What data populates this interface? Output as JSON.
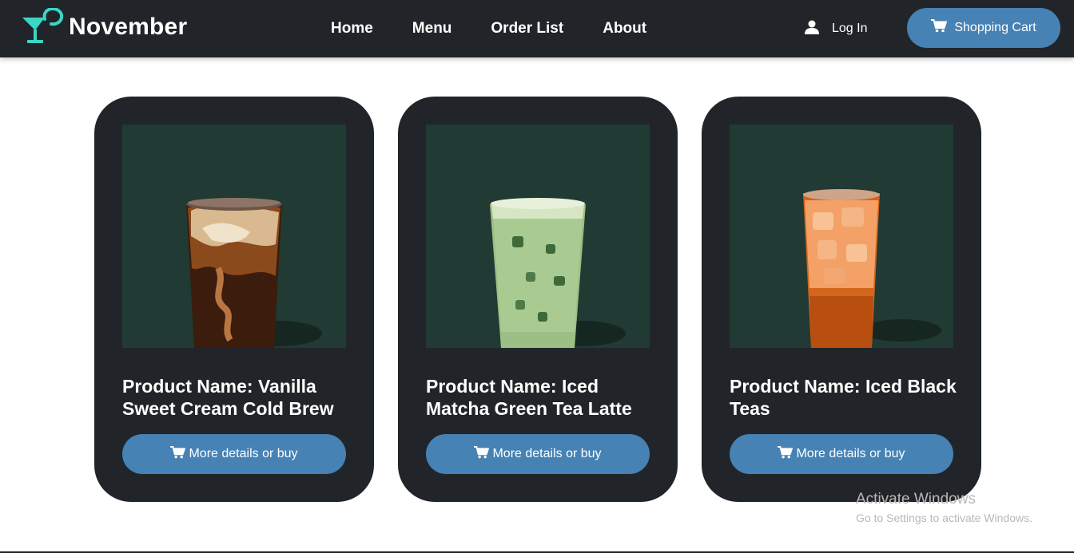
{
  "brand": {
    "name": "November",
    "icon": "cocktail-glass-icon",
    "accent": "#3ad6c6"
  },
  "nav": {
    "links": [
      "Home",
      "Menu",
      "Order List",
      "About"
    ],
    "login_label": "Log In",
    "cart_label": "Shopping Cart"
  },
  "colors": {
    "navbar": "#212529",
    "button": "#4682b4",
    "card": "#212529",
    "image_bg": "#213a33"
  },
  "products": [
    {
      "title": "Product Name: Vanilla Sweet Cream Cold Brew",
      "button": "More details or buy",
      "image": "vanilla-sweet-cream-cold-brew-photo"
    },
    {
      "title": "Product Name: Iced Matcha Green Tea Latte",
      "button": "More details or buy",
      "image": "iced-matcha-green-tea-latte-photo"
    },
    {
      "title": "Product Name: Iced Black Teas",
      "button": "More details or buy",
      "image": "iced-black-teas-photo"
    }
  ],
  "watermark": {
    "title": "Activate Windows",
    "subtitle": "Go to Settings to activate Windows."
  }
}
